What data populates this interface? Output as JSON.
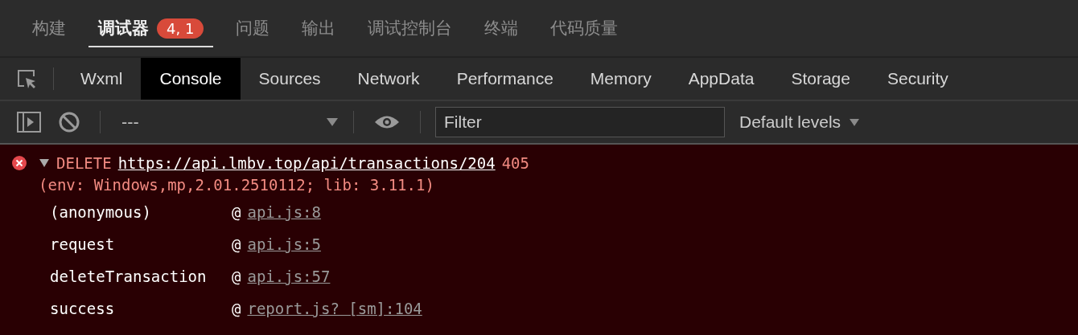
{
  "top_tabs": [
    {
      "label": "构建",
      "selected": false
    },
    {
      "label": "调试器",
      "selected": true,
      "badge": "4, 1"
    },
    {
      "label": "问题",
      "selected": false
    },
    {
      "label": "输出",
      "selected": false
    },
    {
      "label": "调试控制台",
      "selected": false
    },
    {
      "label": "终端",
      "selected": false
    },
    {
      "label": "代码质量",
      "selected": false
    }
  ],
  "devtools_tabs": [
    {
      "label": "Wxml",
      "selected": false
    },
    {
      "label": "Console",
      "selected": true
    },
    {
      "label": "Sources",
      "selected": false
    },
    {
      "label": "Network",
      "selected": false
    },
    {
      "label": "Performance",
      "selected": false
    },
    {
      "label": "Memory",
      "selected": false
    },
    {
      "label": "AppData",
      "selected": false
    },
    {
      "label": "Storage",
      "selected": false
    },
    {
      "label": "Security",
      "selected": false
    }
  ],
  "console_toolbar": {
    "context": "---",
    "filter": {
      "placeholder": "Filter"
    },
    "levels": "Default levels"
  },
  "error": {
    "expanded": true,
    "method": "DELETE",
    "url": "https://api.lmbv.top/api/transactions/204",
    "status": "405",
    "env": "(env: Windows,mp,2.01.2510112; lib: 3.11.1)",
    "stack": [
      {
        "function": "(anonymous)",
        "at": "@",
        "source": "api.js:8"
      },
      {
        "function": "request",
        "at": "@",
        "source": "api.js:5"
      },
      {
        "function": "deleteTransaction",
        "at": "@",
        "source": "api.js:57"
      },
      {
        "function": "success",
        "at": "@",
        "source": "report.js? [sm]:104"
      }
    ]
  }
}
